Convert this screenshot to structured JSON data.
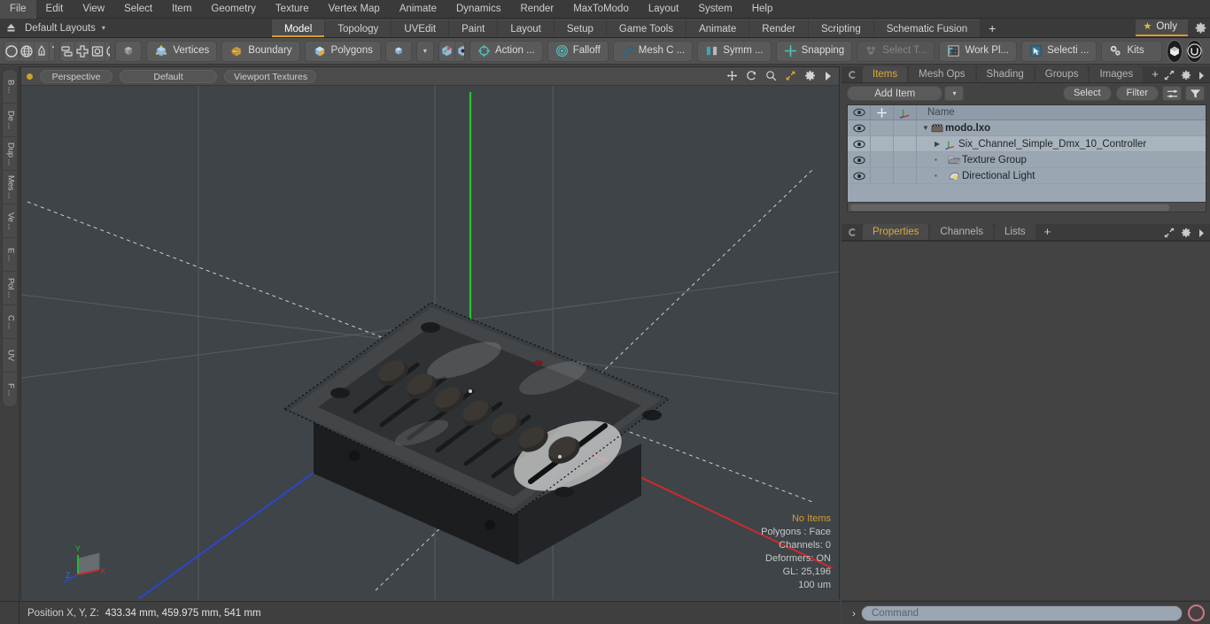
{
  "menubar": {
    "items": [
      "File",
      "Edit",
      "View",
      "Select",
      "Item",
      "Geometry",
      "Texture",
      "Vertex Map",
      "Animate",
      "Dynamics",
      "Render",
      "MaxToModo",
      "Layout",
      "System",
      "Help"
    ]
  },
  "layoutbar": {
    "home_icon": "home-up-icon",
    "layouts_label": "Default Layouts",
    "caret": "▾",
    "tabs": [
      {
        "label": "Model",
        "active": true
      },
      {
        "label": "Topology",
        "active": false
      },
      {
        "label": "UVEdit",
        "active": false
      },
      {
        "label": "Paint",
        "active": false
      },
      {
        "label": "Layout",
        "active": false
      },
      {
        "label": "Setup",
        "active": false
      },
      {
        "label": "Game Tools",
        "active": false
      },
      {
        "label": "Animate",
        "active": false
      },
      {
        "label": "Render",
        "active": false
      },
      {
        "label": "Scripting",
        "active": false
      },
      {
        "label": "Schematic Fusion",
        "active": false
      }
    ],
    "add_tab": "+",
    "only_label": "Only",
    "only_star": "★",
    "gear_icon": "gear-icon"
  },
  "toolbar": {
    "shape_icons": [
      "circle-icon",
      "globe-icon",
      "pen-icon",
      "curve-icon"
    ],
    "arrange_icons": [
      "stack-icon",
      "crosshair-plus-icon",
      "frame-icon",
      "circle-slash-icon"
    ],
    "cube_icon": "cube-icon",
    "selection_modes": [
      {
        "label": "Vertices",
        "icon": "vertices-cube-icon"
      },
      {
        "label": "Boundary",
        "icon": "boundary-cube-icon"
      },
      {
        "label": "Polygons",
        "icon": "polygons-cube-icon"
      }
    ],
    "item_mode_icon": "item-cube-icon",
    "item_caret": "▾",
    "pivot_icons": [
      "pivot-cube-icon",
      "center-cube-icon"
    ],
    "buttons": [
      {
        "label": "Action   ...",
        "icon": "action-center-icon",
        "dim": false
      },
      {
        "label": "Falloff",
        "icon": "falloff-icon",
        "dim": false
      },
      {
        "label": "Mesh C ...",
        "icon": "mesh-constraint-icon",
        "dim": false
      },
      {
        "label": "Symm ...",
        "icon": "symmetry-icon",
        "dim": false
      },
      {
        "label": "Snapping",
        "icon": "snapping-icon",
        "dim": false
      },
      {
        "label": "Select T...",
        "icon": "select-through-icon",
        "dim": true
      },
      {
        "label": "Work Pl...",
        "icon": "work-plane-icon",
        "dim": false
      },
      {
        "label": "Selecti ...",
        "icon": "selection-cursor-icon",
        "dim": false
      },
      {
        "label": "Kits",
        "icon": "kits-gear-icon",
        "dim": false
      }
    ],
    "round_buttons": [
      "modo-logo-icon",
      "unreal-logo-icon"
    ]
  },
  "left_strip": {
    "tabs": [
      "B ...",
      "De ...",
      "Dup ...",
      "Mes ...",
      "Ve ...",
      "E ...",
      "Pol ...",
      "C ...",
      "UV",
      "F ..."
    ]
  },
  "viewport": {
    "header": {
      "indicator": "active-dot",
      "pills": [
        "Perspective",
        "Default",
        "Viewport Textures"
      ],
      "tools": [
        "move-icon",
        "rotate-icon",
        "zoom-icon",
        "fit-icon",
        "gear-icon",
        "play-arrow-icon"
      ]
    },
    "stats": [
      {
        "text": "No Items",
        "highlight": true
      },
      {
        "text": "Polygons : Face",
        "highlight": false
      },
      {
        "text": "Channels: 0",
        "highlight": false
      },
      {
        "text": "Deformers: ON",
        "highlight": false
      },
      {
        "text": "GL: 25,196",
        "highlight": false
      },
      {
        "text": "100 um",
        "highlight": false
      }
    ],
    "gizmo": {
      "x": "X",
      "y": "Y",
      "z": "Z"
    },
    "scene_object": "Six channel DMX fader controller box",
    "colors": {
      "background": "#3e4448",
      "axis_x": "#cc2b2b",
      "axis_y": "#27c42b",
      "axis_z": "#2b47cc",
      "grid": "#5a6166"
    }
  },
  "statusbar": {
    "label": "Position X, Y, Z:",
    "value": "433.34 mm, 459.975 mm, 541 mm"
  },
  "right_panel": {
    "top_tabs": [
      {
        "label": "Items",
        "active": true
      },
      {
        "label": "Mesh Ops",
        "active": false
      },
      {
        "label": "Shading",
        "active": false
      },
      {
        "label": "Groups",
        "active": false
      },
      {
        "label": "Images",
        "active": false
      }
    ],
    "top_tabs_plus": "+",
    "panel_tools": [
      "expand-icon",
      "gear-icon",
      "chevron-right-icon"
    ],
    "add_item_label": "Add Item",
    "add_item_caret": "▾",
    "select_label": "Select",
    "filter_label": "Filter",
    "filter_icons": [
      "sliders-icon",
      "funnel-icon"
    ],
    "tree_header": {
      "col_eye": "eye-icon",
      "col_lock": "move-lock-icon",
      "col_axis": "axis-icon",
      "col_name": "Name"
    },
    "tree_rows": [
      {
        "label": "modo.lxo",
        "icon": "scene-clapper-icon",
        "indent": 0,
        "expanded": true,
        "bold": true,
        "eye": true
      },
      {
        "label": "Six_Channel_Simple_Dmx_10_Controller",
        "icon": "mesh-axis-icon",
        "indent": 1,
        "expanded": false,
        "bold": false,
        "eye": true
      },
      {
        "label": "Texture Group",
        "icon": "texture-group-icon",
        "indent": 1,
        "expanded": null,
        "bold": false,
        "eye": true
      },
      {
        "label": "Directional Light",
        "icon": "directional-light-icon",
        "indent": 1,
        "expanded": null,
        "bold": false,
        "eye": true
      }
    ],
    "bottom_tabs": [
      {
        "label": "Properties",
        "active": true
      },
      {
        "label": "Channels",
        "active": false
      },
      {
        "label": "Lists",
        "active": false
      }
    ],
    "bottom_tabs_plus": "+"
  },
  "commandbar": {
    "prompt": "›",
    "placeholder": "Command",
    "value": "",
    "record_icon": "record-circle-icon"
  },
  "colors": {
    "accent_orange": "#e0a93b",
    "chrome_dark": "#3a3a3a",
    "chrome_mid": "#434343",
    "toolbar": "#515151",
    "tree_bg": "#9aa6b2"
  }
}
